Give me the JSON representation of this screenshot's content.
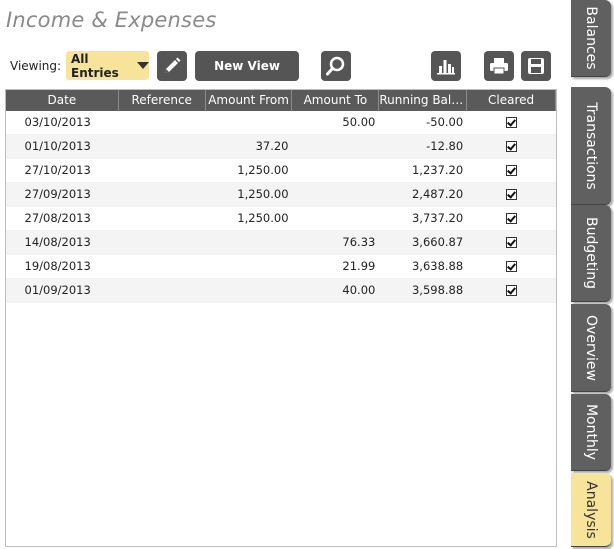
{
  "app": {
    "title": "Income & Expenses"
  },
  "toolbar": {
    "viewing_label": "Viewing:",
    "view_selected": "All Entries",
    "new_view_label": "New View",
    "icons": [
      "pencil-icon",
      "search-icon",
      "chart-icon",
      "printer-icon",
      "save-icon"
    ]
  },
  "table": {
    "columns": [
      "Date",
      "Reference",
      "Amount From",
      "Amount To",
      "Running Balan...",
      "Cleared"
    ],
    "rows": [
      {
        "date": "03/10/2013",
        "reference": "",
        "amount_from": "",
        "amount_to": "50.00",
        "running": "-50.00",
        "cleared": true
      },
      {
        "date": "01/10/2013",
        "reference": "",
        "amount_from": "37.20",
        "amount_to": "",
        "running": "-12.80",
        "cleared": true
      },
      {
        "date": "27/10/2013",
        "reference": "",
        "amount_from": "1,250.00",
        "amount_to": "",
        "running": "1,237.20",
        "cleared": true
      },
      {
        "date": "27/09/2013",
        "reference": "",
        "amount_from": "1,250.00",
        "amount_to": "",
        "running": "2,487.20",
        "cleared": true
      },
      {
        "date": "27/08/2013",
        "reference": "",
        "amount_from": "1,250.00",
        "amount_to": "",
        "running": "3,737.20",
        "cleared": true
      },
      {
        "date": "14/08/2013",
        "reference": "",
        "amount_from": "",
        "amount_to": "76.33",
        "running": "3,660.87",
        "cleared": true
      },
      {
        "date": "19/08/2013",
        "reference": "",
        "amount_from": "",
        "amount_to": "21.99",
        "running": "3,638.88",
        "cleared": true
      },
      {
        "date": "01/09/2013",
        "reference": "",
        "amount_from": "",
        "amount_to": "40.00",
        "running": "3,598.88",
        "cleared": true
      }
    ]
  },
  "side_tabs": [
    {
      "label": "Balances",
      "active": false
    },
    {
      "label": "Transactions",
      "active": false
    },
    {
      "label": "Budgeting",
      "active": false
    },
    {
      "label": "Overview",
      "active": false
    },
    {
      "label": "Monthly",
      "active": false
    },
    {
      "label": "Analysis",
      "active": true
    }
  ],
  "colors": {
    "accent": "#f7e39a",
    "button_bg": "#555555",
    "header_bg": "#5a5a5a",
    "tab_bg": "#606060"
  }
}
